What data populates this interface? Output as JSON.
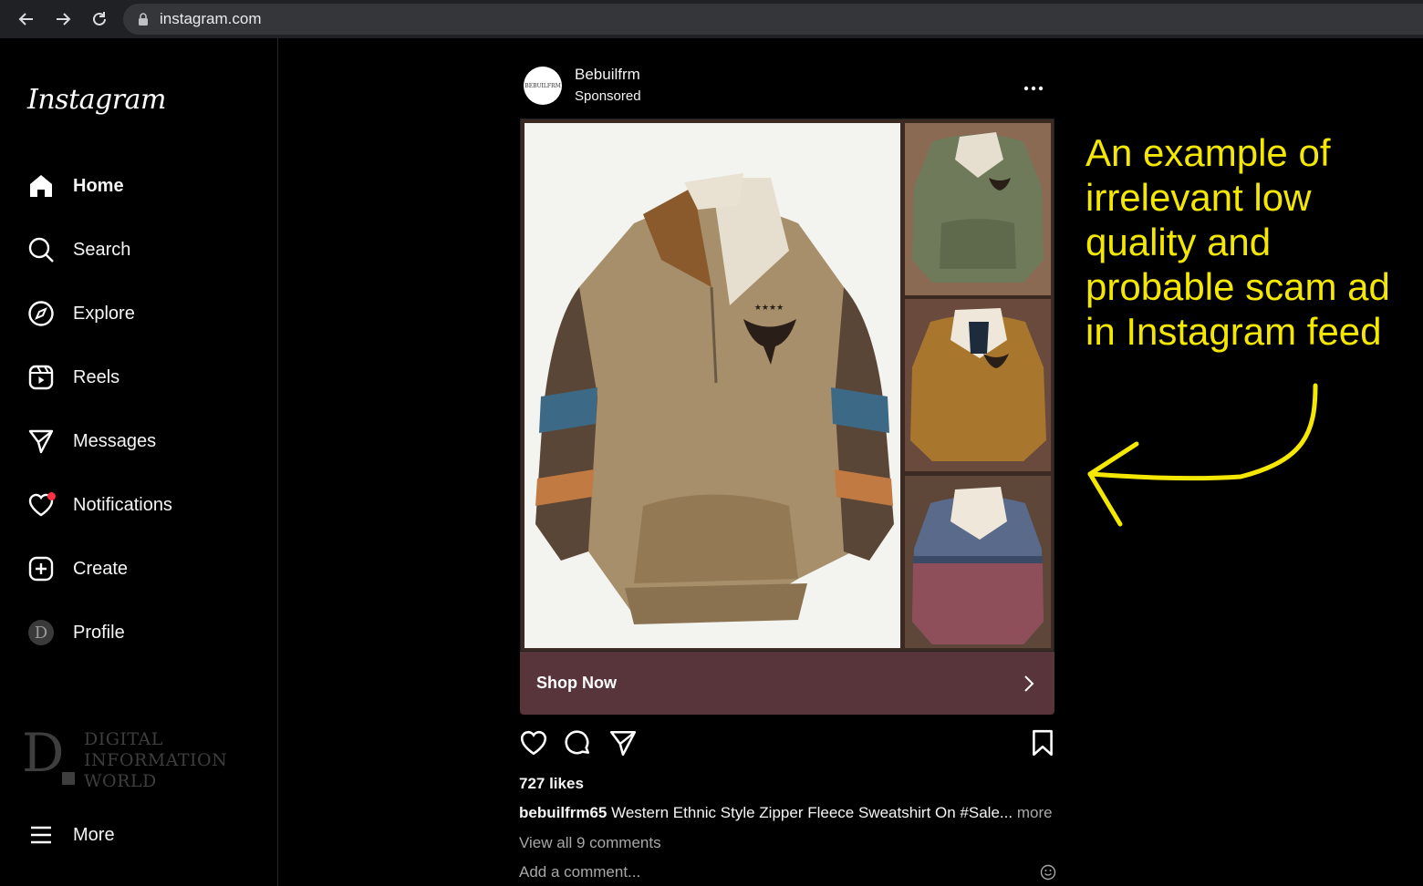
{
  "browser": {
    "url": "instagram.com"
  },
  "sidebar": {
    "logo": "Instagram",
    "items": [
      {
        "label": "Home",
        "icon": "home-icon"
      },
      {
        "label": "Search",
        "icon": "search-icon"
      },
      {
        "label": "Explore",
        "icon": "compass-icon"
      },
      {
        "label": "Reels",
        "icon": "reels-icon"
      },
      {
        "label": "Messages",
        "icon": "send-icon"
      },
      {
        "label": "Notifications",
        "icon": "heart-icon"
      },
      {
        "label": "Create",
        "icon": "plus-square-icon"
      },
      {
        "label": "Profile",
        "icon": "avatar-icon",
        "avatar_letter": "D"
      }
    ],
    "more_label": "More"
  },
  "watermark": {
    "letter": "D",
    "lines": [
      "DIGITAL",
      "INFORMATION",
      "WORLD"
    ]
  },
  "post": {
    "avatar_text": "BEBUILFRM",
    "username": "Bebuilfrm",
    "sponsored": "Sponsored",
    "cta": "Shop Now",
    "likes": "727 likes",
    "caption_user": "bebuilfrm65",
    "caption_text": "Western Ethnic Style Zipper Fleece Sweatshirt On #Sale...",
    "caption_more": "more",
    "view_comments": "View all 9 comments",
    "comment_placeholder": "Add a comment..."
  },
  "annotation": {
    "text": "An example of irrelevant low quality and probable scam ad in Instagram feed",
    "color": "#f5e800"
  },
  "colors": {
    "shop_bar": "#58353a",
    "notification_dot": "#ff3040",
    "background": "#000000"
  }
}
